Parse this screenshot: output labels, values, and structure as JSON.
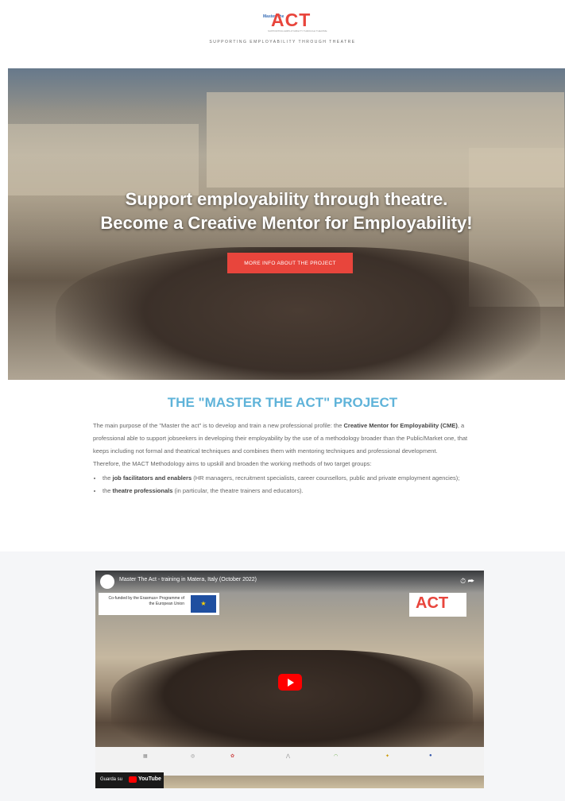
{
  "header": {
    "logo_text": "ACT",
    "logo_prefix": "Master The",
    "logo_sub": "SUPPORTING EMPLOYABILITY THROUGH THEATRE",
    "tagline": "SUPPORTING EMPLOYABILITY THROUGH THEATRE"
  },
  "hero": {
    "title_line1": "Support employability through theatre.",
    "title_line2": "Become a Creative Mentor for Employability!",
    "button_label": "MORE INFO ABOUT THE PROJECT"
  },
  "project": {
    "title": "THE \"MASTER THE ACT\" PROJECT",
    "p1_a": "The main purpose of the \"Master the act\" is to develop and train a new professional profile: the ",
    "p1_b": "Creative Mentor for Employability (CME)",
    "p1_c": ", a professional able to support jobseekers in developing their employability by the use of a methodology broader than the Public/Market one, that keeps including not formal and theatrical techniques and combines them with mentoring techniques and professional development.",
    "p2": "Therefore, the MACT Methodology aims to upskill and broaden the working methods of two target groups:",
    "li1_a": "the ",
    "li1_b": "job facilitators and enablers",
    "li1_c": " (HR managers, recruitment specialists, career counsellors, public and private employment agencies);",
    "li2_a": "the ",
    "li2_b": "theatre professionals",
    "li2_c": " (in particular, the theatre trainers and educators)."
  },
  "video": {
    "title": "Master The Act - training in Matera, Italy (October 2022)",
    "eu_text": "Co-funded by the Erasmus+ Programme of the European Union",
    "act_logo": "ACT",
    "watch_on": "Guarda su",
    "youtube": "YouTube",
    "partners": [
      "",
      "",
      "",
      "",
      "",
      "",
      ""
    ]
  },
  "colors": {
    "accent_red": "#e8453c",
    "title_blue": "#5fb3d9"
  }
}
